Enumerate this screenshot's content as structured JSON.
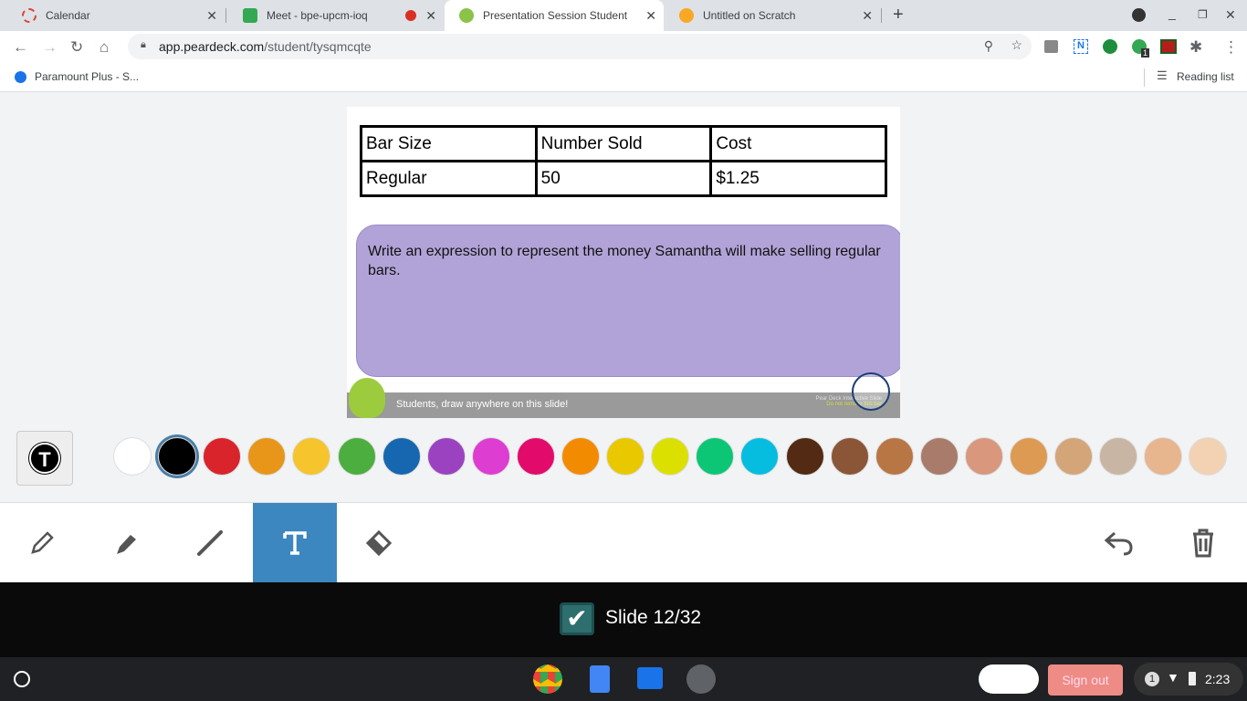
{
  "tabs": [
    {
      "title": "Calendar",
      "color": "#db4437"
    },
    {
      "title": "Meet - bpe-upcm-ioq",
      "color": "#34a853"
    },
    {
      "title": "Presentation Session Student",
      "color": "#8bc34a"
    },
    {
      "title": "Untitled on Scratch",
      "color": "#f9a825"
    }
  ],
  "address": {
    "host": "app.peardeck.com",
    "path": "/student/tysqmcqte"
  },
  "bookmarks": {
    "item": "Paramount Plus - S...",
    "reading_list": "Reading list"
  },
  "extension_badge": "1",
  "slide": {
    "table": {
      "headers": [
        "Bar Size",
        "Number Sold",
        "Cost"
      ],
      "rows": [
        [
          "Regular",
          "50",
          "$1.25"
        ]
      ]
    },
    "prompt": "Write an expression to represent the money Samantha will make selling regular bars.",
    "footer": "Students, draw anywhere on this slide!",
    "footer_right_1": "Pear Deck Interactive Slide",
    "footer_right_2": "Do not remove this bar"
  },
  "palette": [
    "#ffffff",
    "#000000",
    "#d9242b",
    "#e8961a",
    "#f6c42c",
    "#4cae3f",
    "#1667b0",
    "#9b42c0",
    "#dd3dd1",
    "#e20b6b",
    "#f38b00",
    "#e9c800",
    "#dce000",
    "#0cc676",
    "#06bde0",
    "#532a13",
    "#8b5638",
    "#b97645",
    "#a97b6a",
    "#d9977d",
    "#dd9a52",
    "#d4a579",
    "#c8b5a3",
    "#e7b58e",
    "#f3d2b4"
  ],
  "selected_color": "#000000",
  "active_tool": "text",
  "slide_label": "Slide 12/32",
  "shelf": {
    "sign_out": "Sign out",
    "notif_count": "1",
    "time": "2:23"
  }
}
